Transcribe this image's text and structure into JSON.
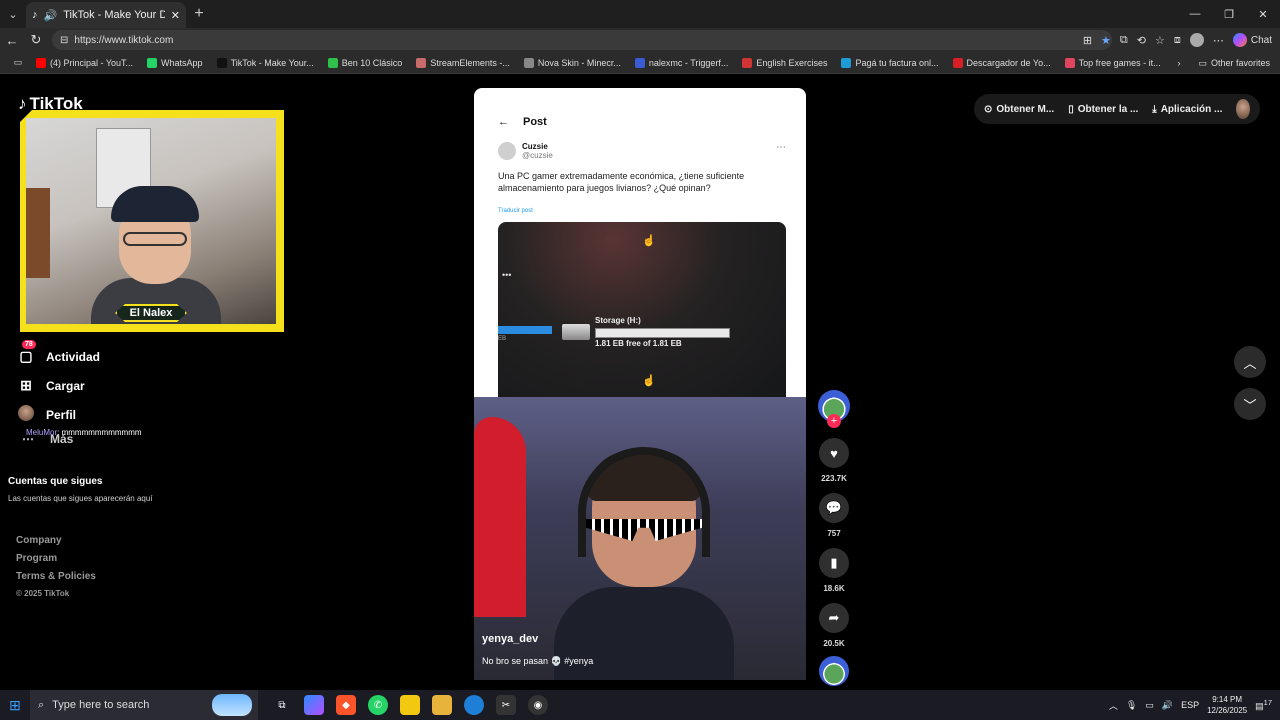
{
  "browser": {
    "tab_title": "TikTok - Make Your Day",
    "url": "https://www.tiktok.com",
    "copilot_label": "Chat",
    "bookmarks": [
      {
        "label": "(4) Principal - YouT...",
        "color": "#ff0000"
      },
      {
        "label": "WhatsApp",
        "color": "#25d366"
      },
      {
        "label": "TikTok - Make Your...",
        "color": "#111111"
      },
      {
        "label": "Ben 10 Clásico",
        "color": "#2fbf4a"
      },
      {
        "label": "StreamElements -...",
        "color": "#c96b6b"
      },
      {
        "label": "Nova Skin - Minecr...",
        "color": "#888888"
      },
      {
        "label": "nalexmc - Triggerf...",
        "color": "#3a5bd6"
      },
      {
        "label": "English Exercises",
        "color": "#d13434"
      },
      {
        "label": "Pagá tu factura onl...",
        "color": "#1e9bd7"
      },
      {
        "label": "Descargador de Yo...",
        "color": "#d81f26"
      },
      {
        "label": "Top free games - it...",
        "color": "#e0455f"
      }
    ],
    "other_favorites": "Other favorites"
  },
  "tiktok": {
    "logo": "TikTok",
    "streamer_name": "El Nalex",
    "nav": {
      "activity": "Actividad",
      "activity_badge": "78",
      "upload": "Cargar",
      "profile": "Perfil",
      "more": "Más"
    },
    "chat_overlay": {
      "user": "MeluMor",
      "text": ": mmmmmmmmmmmm"
    },
    "following": {
      "heading": "Cuentas que sigues",
      "text": "Las cuentas que sigues aparecerán aquí"
    },
    "footer": {
      "company": "Company",
      "program": "Program",
      "terms": "Terms & Policies",
      "copyright": "© 2025 TikTok"
    },
    "top_right": {
      "get_coins": "Obtener M...",
      "get_app": "Obtener la ...",
      "desktop_app": "Aplicación ..."
    },
    "post": {
      "header": "Post",
      "author": "Cuzsie",
      "handle": "@cuzsie",
      "text": "Una PC gamer extremadamente económica, ¿tiene suficiente almacenamiento para juegos  livianos? ¿Qué opinan?",
      "translate": "Traducir post",
      "storage_title": "Storage (H:)",
      "storage_free": "1.81 EB free of 1.81 EB",
      "storage_left_label": "EB"
    },
    "video": {
      "username": "yenya_dev",
      "caption": "No bro se pasan 💀 #yenya"
    },
    "actions": {
      "likes": "223.7K",
      "comments": "757",
      "saves": "18.6K",
      "shares": "20.5K"
    }
  },
  "taskbar": {
    "search_placeholder": "Type here to search",
    "language": "ESP",
    "time": "9:14 PM",
    "date": "12/26/2025",
    "notif_count": "17"
  }
}
